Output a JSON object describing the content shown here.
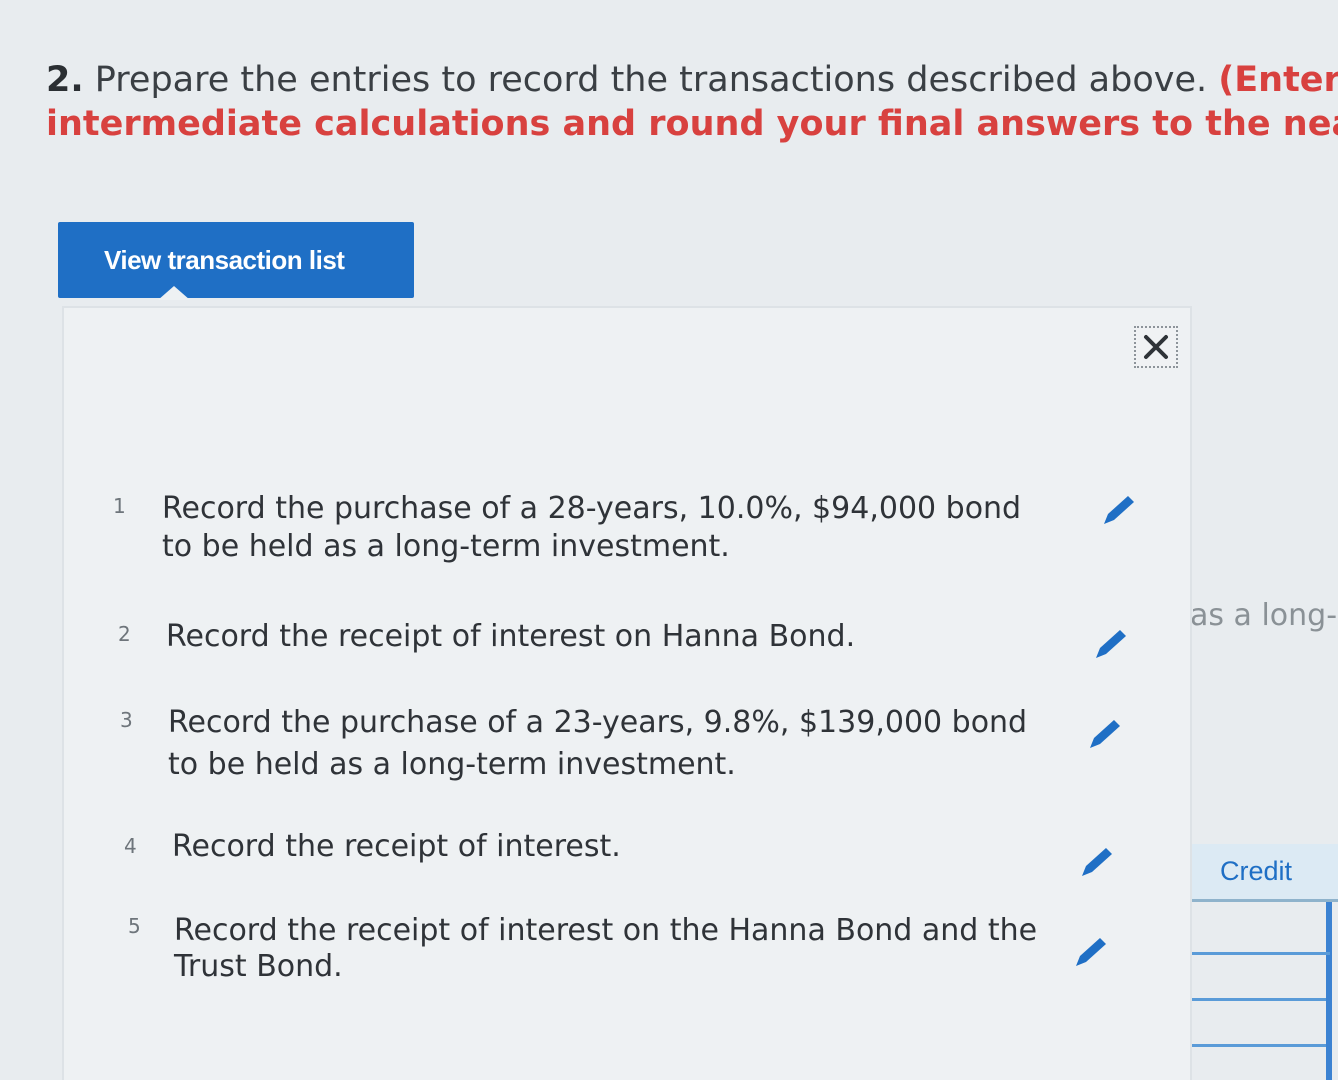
{
  "question": {
    "number": "2.",
    "text": "Prepare the entries to record the transactions described above.",
    "instruction_line1": "(Enter all th",
    "instruction_line2": "intermediate calculations and round your final answers to the nearest dollar."
  },
  "view_button": {
    "label": "View transaction list"
  },
  "transactions": [
    {
      "number": "1",
      "line1": "Record the purchase of a 28-years, 10.0%, $94,000 bond",
      "line2": "to be held as a long-term investment."
    },
    {
      "number": "2",
      "line1": "Record the receipt of interest on Hanna Bond.",
      "line2": ""
    },
    {
      "number": "3",
      "line1": "Record the purchase of a 23-years, 9.8%, $139,000 bond",
      "line2": "to be held as a long-term investment."
    },
    {
      "number": "4",
      "line1": "Record the receipt of interest.",
      "line2": ""
    },
    {
      "number": "5",
      "line1": "Record the receipt of interest on the Hanna Bond and the",
      "line2": "Trust Bond."
    }
  ],
  "background": {
    "partial_text": "as a long-",
    "credit_header": "Credit"
  },
  "colors": {
    "accent": "#1f6fc5",
    "instruction_red": "#d8413f",
    "edit_icon": "#1f6fc5"
  },
  "icons": {
    "close": "close-icon",
    "edit": "pencil-icon"
  }
}
